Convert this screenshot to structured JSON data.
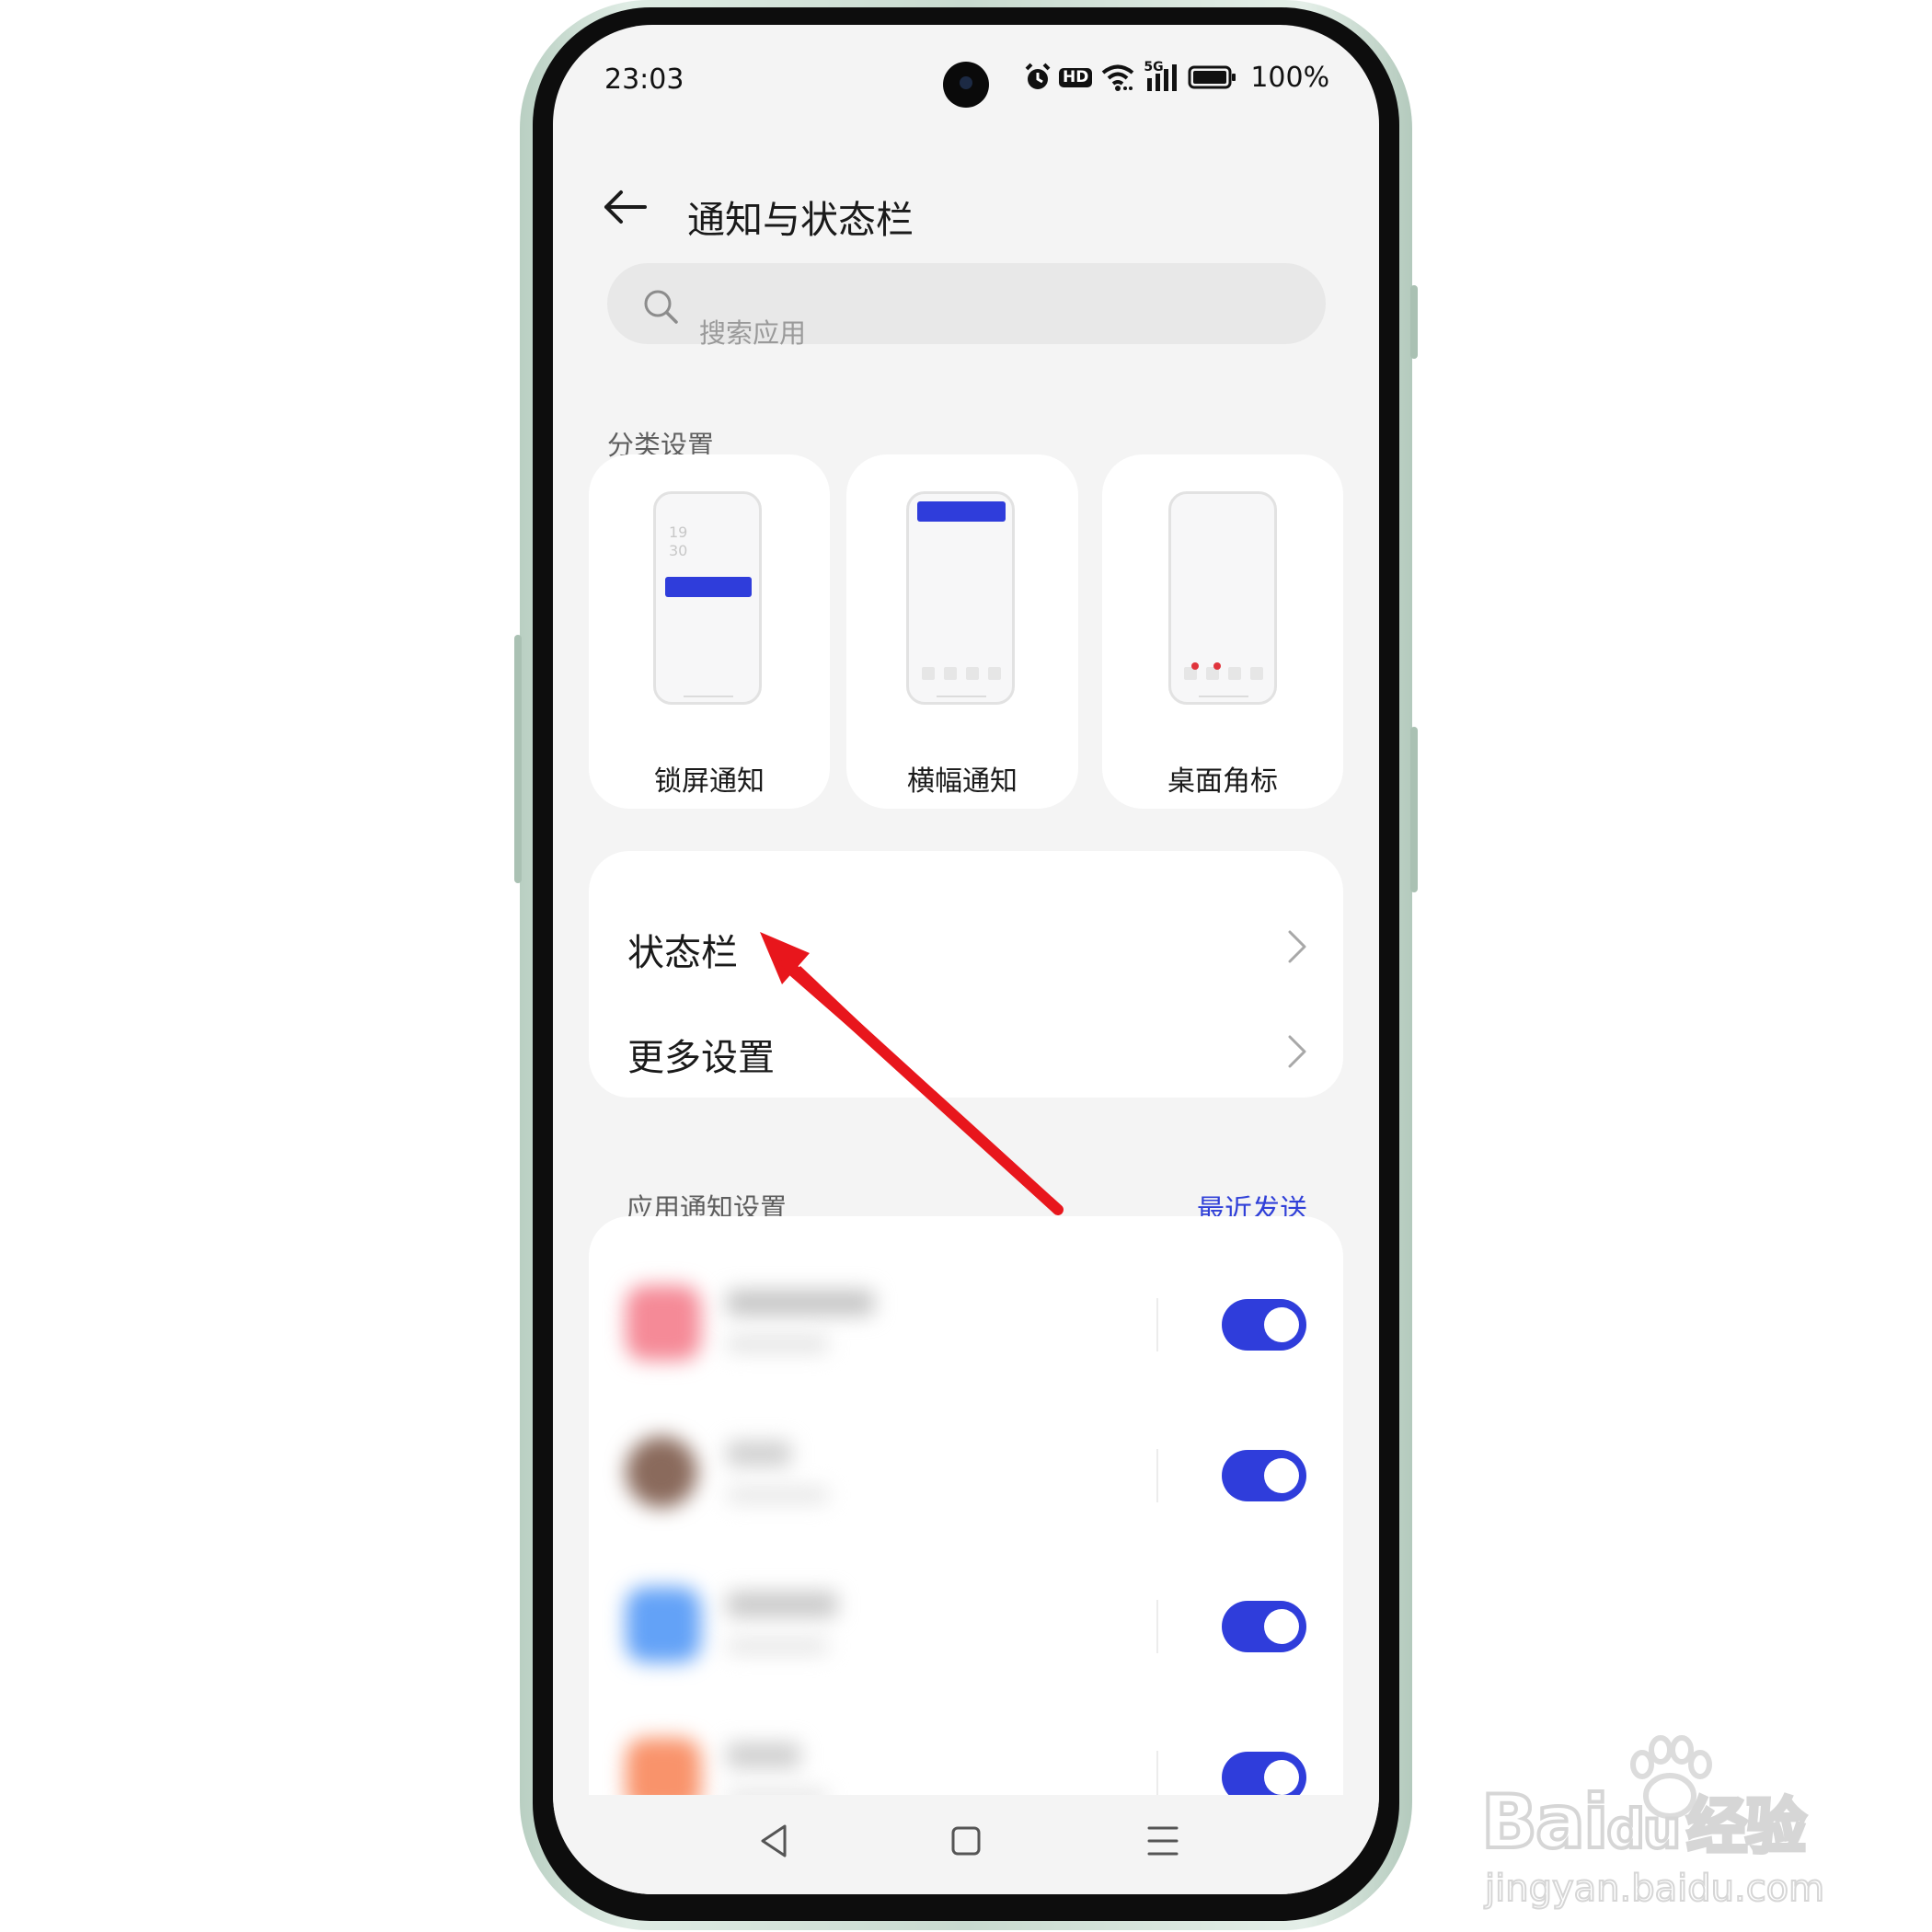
{
  "status_bar": {
    "time": "23:03",
    "hd_badge": "HD",
    "network": "5G",
    "battery_percent": "100%",
    "icons": [
      "alarm-icon",
      "hd-icon",
      "wifi-icon",
      "signal-5g-icon",
      "battery-icon"
    ]
  },
  "header": {
    "back_icon": "arrow-left-icon",
    "title": "通知与状态栏"
  },
  "search": {
    "placeholder": "搜索应用",
    "icon": "search-icon"
  },
  "category_section": {
    "label": "分类设置",
    "items": [
      {
        "label": "锁屏通知",
        "preview_clock": "19\n30"
      },
      {
        "label": "横幅通知"
      },
      {
        "label": "桌面角标"
      }
    ]
  },
  "settings_list": {
    "items": [
      {
        "label": "状态栏"
      },
      {
        "label": "更多设置"
      }
    ]
  },
  "app_notifications": {
    "label": "应用通知设置",
    "sort_link": "最近发送",
    "apps": [
      {
        "icon_color": "#f58a97",
        "enabled": true
      },
      {
        "icon_color": "#8a6a5c",
        "enabled": true
      },
      {
        "icon_color": "#63a2f7",
        "enabled": true
      },
      {
        "icon_color": "#f9936b",
        "enabled": true
      }
    ]
  },
  "nav_bar": {
    "icons": [
      "back-triangle-icon",
      "home-square-icon",
      "menu-lines-icon"
    ]
  },
  "colors": {
    "accent": "#2f3ddb",
    "background": "#f4f4f4",
    "card": "#ffffff",
    "annotation_arrow": "#e8161c"
  },
  "watermark": {
    "brand": "Bai",
    "brand_suffix": "du",
    "brand_cn": "经验",
    "url": "jingyan.baidu.com"
  }
}
